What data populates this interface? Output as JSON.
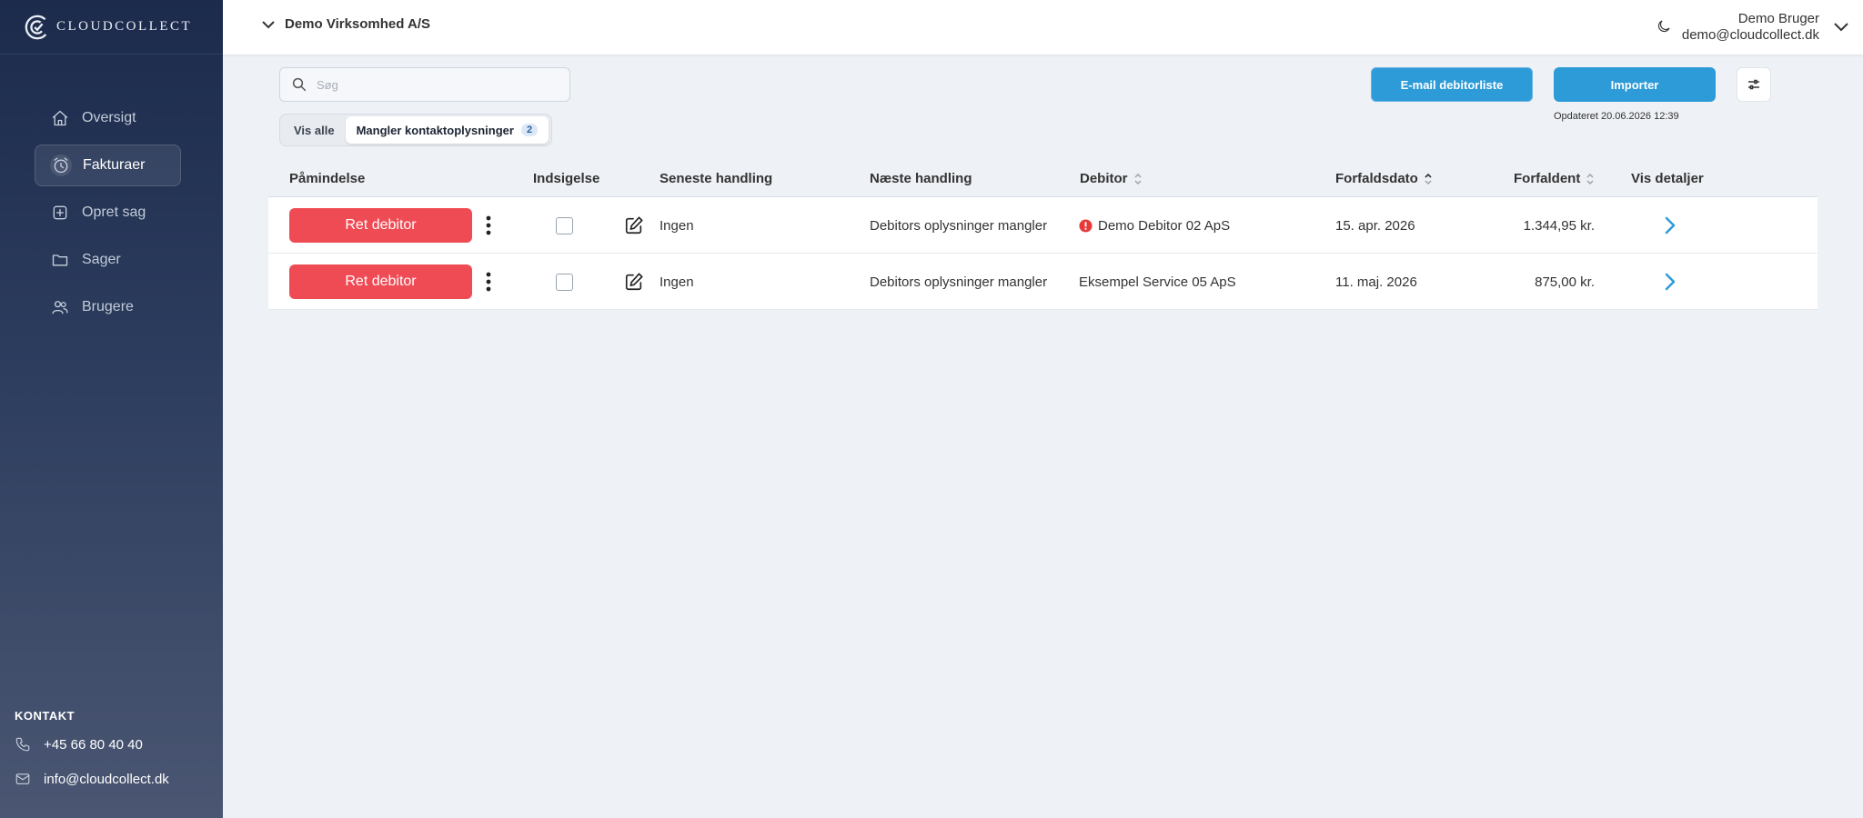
{
  "app": {
    "logo_text": "CLOUDCOLLECT",
    "company": "Demo Virksomhed A/S",
    "user_name": "Demo Bruger",
    "user_email": "demo@cloudcollect.dk"
  },
  "sidebar": {
    "items": [
      {
        "label": "Oversigt",
        "icon": "home-icon",
        "active": false
      },
      {
        "label": "Fakturaer",
        "icon": "clock-icon",
        "active": true
      },
      {
        "label": "Opret sag",
        "icon": "plus-square-icon",
        "active": false
      },
      {
        "label": "Sager",
        "icon": "folder-icon",
        "active": false
      },
      {
        "label": "Brugere",
        "icon": "users-icon",
        "active": false
      }
    ],
    "contact": {
      "title": "KONTAKT",
      "phone": "+45 66 80 40 40",
      "email": "info@cloudcollect.dk"
    }
  },
  "toolbar": {
    "search_placeholder": "Søg",
    "tabs": [
      {
        "label": "Vis alle",
        "active": false
      },
      {
        "label": "Mangler kontaktoplysninger",
        "active": true,
        "count": "2"
      }
    ],
    "email_button": "E-mail debitorliste",
    "import_button": "Importer",
    "updated": "Opdateret 20.06.2026 12:39"
  },
  "table": {
    "columns": [
      "Påmindelse",
      "Indsigelse",
      "Seneste handling",
      "Næste handling",
      "Debitor",
      "Forfaldsdato",
      "Forfaldent",
      "Vis detaljer"
    ],
    "rows": [
      {
        "action_label": "Ret debitor",
        "latest": "Ingen",
        "next": "Debitors oplysninger mangler",
        "debtor": "Demo Debitor 02 ApS",
        "warning": true,
        "due_date": "15. apr. 2026",
        "amount": "1.344,95 kr."
      },
      {
        "action_label": "Ret debitor",
        "latest": "Ingen",
        "next": "Debitors oplysninger mangler",
        "debtor": "Eksempel Service 05 ApS",
        "warning": false,
        "due_date": "11. maj. 2026",
        "amount": "875,00 kr."
      }
    ]
  },
  "colors": {
    "accent": "#2d9bd8",
    "danger": "#ef4b54",
    "sidebar_top": "#1c2b4c",
    "sidebar_bottom": "#4a5672"
  }
}
